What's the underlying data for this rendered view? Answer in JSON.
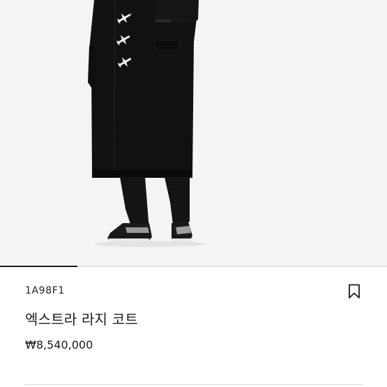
{
  "product": {
    "sku": "1A98F1",
    "name": "엑스트라 라지 코트",
    "price": "₩8,540,000"
  },
  "gallery": {
    "image_subject": "black long coat with airplane embroidery",
    "indicator_position": 1,
    "indicator_total": 5
  },
  "icons": {
    "wishlist": "bookmark-icon"
  },
  "colors": {
    "text": "#1c1c1c",
    "background": "#ffffff",
    "image_bg": "#f4f4f4",
    "coat": "#111111"
  }
}
